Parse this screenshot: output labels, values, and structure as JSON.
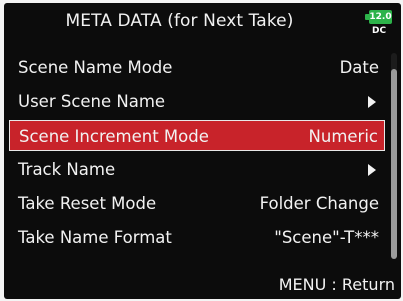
{
  "header": {
    "title": "META DATA (for Next Take)"
  },
  "battery": {
    "level": "12.0",
    "source": "DC",
    "color": "#2db34a"
  },
  "menu": {
    "items": [
      {
        "label": "Scene Name Mode",
        "value": "Date"
      },
      {
        "label": "User Scene Name",
        "value": "",
        "submenu_icon": "right-triangle-icon"
      },
      {
        "label": "Scene Increment Mode",
        "value": "Numeric",
        "selected": true
      },
      {
        "label": "Track Name",
        "value": "",
        "submenu_icon": "right-triangle-icon"
      },
      {
        "label": "Take Reset Mode",
        "value": "Folder Change"
      },
      {
        "label": "Take Name Format",
        "value": "\"Scene\"-T***"
      }
    ]
  },
  "footer": {
    "hint": "MENU : Return"
  },
  "colors": {
    "background": "#0c0c0c",
    "selection": "#c8232a",
    "text": "#f2f2f2"
  }
}
